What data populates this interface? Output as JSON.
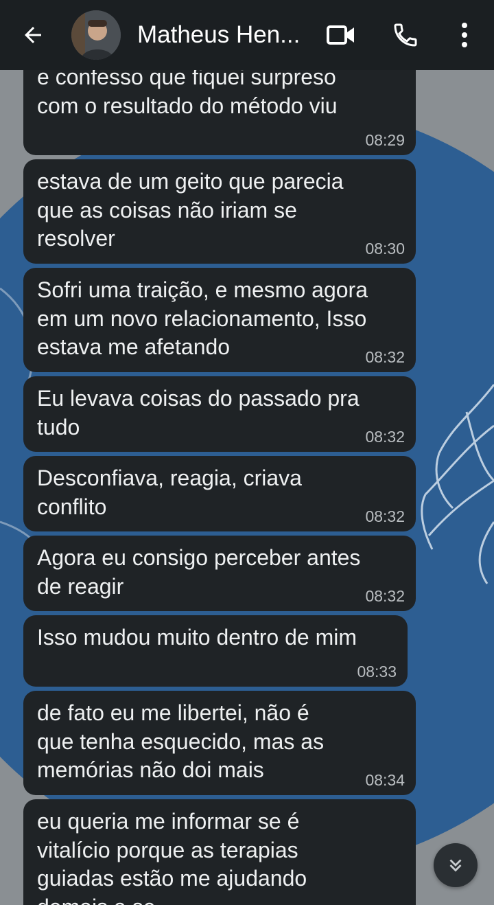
{
  "header": {
    "contact_name": "Matheus Hen...",
    "icons": [
      "arrow-left-icon",
      "video-call-icon",
      "phone-icon",
      "more-vertical-icon"
    ]
  },
  "messages": [
    {
      "text": "e confesso que fiquei surpreso\ncom o resultado do método viu",
      "time": "08:29"
    },
    {
      "text": "estava de um geito que parecia\nque as coisas não iriam se\nresolver",
      "time": "08:30"
    },
    {
      "text": "Sofri uma traição, e mesmo agora\nem um novo relacionamento, Isso\nestava me afetando",
      "time": "08:32"
    },
    {
      "text": "Eu levava coisas do passado pra\ntudo",
      "time": "08:32"
    },
    {
      "text": "Desconfiava, reagia, criava\nconflito",
      "time": "08:32"
    },
    {
      "text": "Agora eu consigo perceber antes\nde reagir",
      "time": "08:32"
    },
    {
      "text": "Isso mudou muito dentro de mim",
      "time": "08:33"
    },
    {
      "text": "de fato eu me libertei, não é\nque tenha esquecido, mas as\nmemórias não doi mais",
      "time": "08:34"
    },
    {
      "text": "eu queria me informar se é\nvitalício porque as terapias\nguiadas estão me ajudando\ndemais a se...",
      "time": ""
    }
  ],
  "colors": {
    "header_bg": "#1b1f22",
    "bubble_bg": "#1f2326",
    "wallpaper_blue": "#2d5e92",
    "wallpaper_gray": "#8a8f93"
  }
}
